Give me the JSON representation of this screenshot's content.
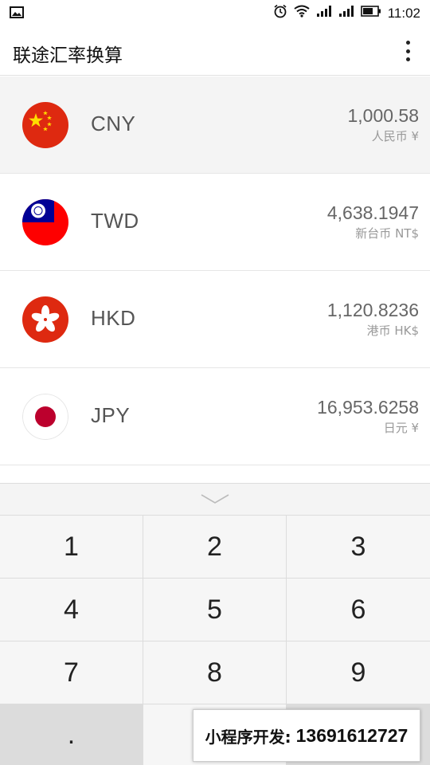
{
  "status_bar": {
    "time": "11:02",
    "icons": [
      "image-notification-icon",
      "alarm-icon",
      "wifi-icon",
      "signal-icon",
      "signal-icon",
      "battery-icon"
    ]
  },
  "app": {
    "title": "联途汇率换算",
    "menu_icon": "more-vertical-icon"
  },
  "currencies": [
    {
      "code": "CNY",
      "amount": "1,000.58",
      "name": "人民币 ¥",
      "flag": "china-flag-icon",
      "selected": true
    },
    {
      "code": "TWD",
      "amount": "4,638.1947",
      "name": "新台币 NT$",
      "flag": "taiwan-flag-icon",
      "selected": false
    },
    {
      "code": "HKD",
      "amount": "1,120.8236",
      "name": "港币 HK$",
      "flag": "hong-kong-flag-icon",
      "selected": false
    },
    {
      "code": "JPY",
      "amount": "16,953.6258",
      "name": "日元 ¥",
      "flag": "japan-flag-icon",
      "selected": false
    }
  ],
  "keypad": {
    "collapse_icon": "chevron-down-icon",
    "keys": [
      "1",
      "2",
      "3",
      "4",
      "5",
      "6",
      "7",
      "8",
      "9",
      "."
    ]
  },
  "watermark": {
    "label": "小程序开发:",
    "phone": "13691612727"
  },
  "colors": {
    "china_red": "#de2910",
    "china_star": "#ffde00",
    "taiwan_blue": "#000095",
    "taiwan_red": "#fe0000",
    "hk_red": "#de2910",
    "japan_red": "#bc002d"
  }
}
